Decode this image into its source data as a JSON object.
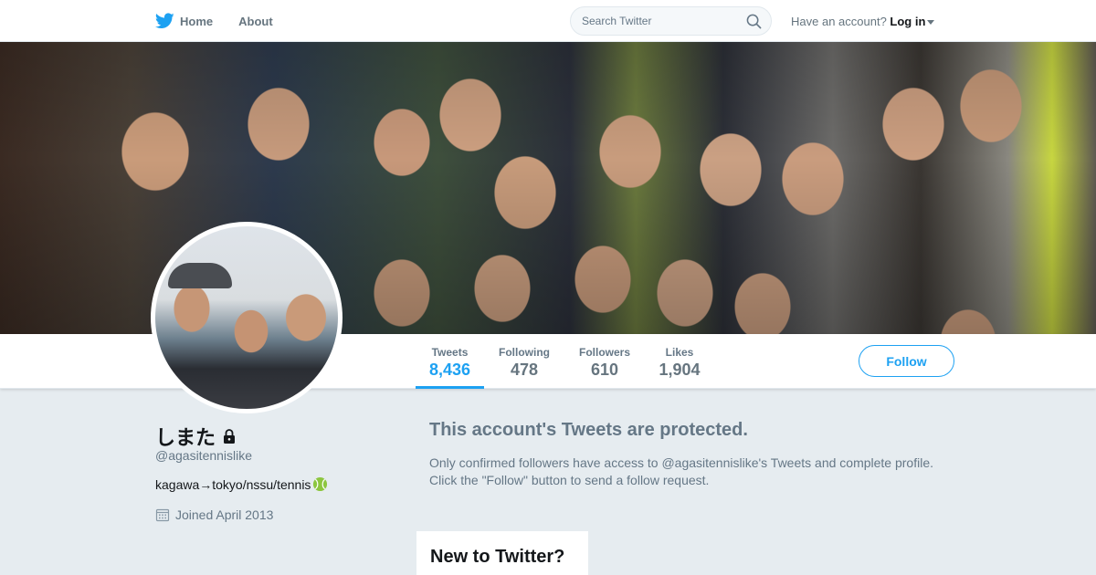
{
  "nav": {
    "home_label": "Home",
    "about_label": "About",
    "search_placeholder": "Search Twitter",
    "login_prefix": "Have an account?",
    "login_label": "Log in",
    "brand_color": "#1da1f2"
  },
  "profile": {
    "name": "しまた",
    "handle": "@agasitennislike",
    "bio": "kagawa→tokyo/nssu/tennis",
    "joined": "Joined April 2013",
    "protected": true
  },
  "stats": [
    {
      "label": "Tweets",
      "value": "8,436",
      "active": true
    },
    {
      "label": "Following",
      "value": "478",
      "active": false
    },
    {
      "label": "Followers",
      "value": "610",
      "active": false
    },
    {
      "label": "Likes",
      "value": "1,904",
      "active": false
    }
  ],
  "follow_label": "Follow",
  "protected_notice": {
    "title": "This account's Tweets are protected.",
    "body": "Only confirmed followers have access to @agasitennislike's Tweets and complete profile. Click the \"Follow\" button to send a follow request."
  },
  "signup_card": {
    "title": "New to Twitter?"
  },
  "icons": [
    "twitter-bird-icon",
    "home-icon",
    "search-icon",
    "lock-icon",
    "tennis-ball-icon",
    "calendar-icon",
    "chevron-down-icon"
  ]
}
